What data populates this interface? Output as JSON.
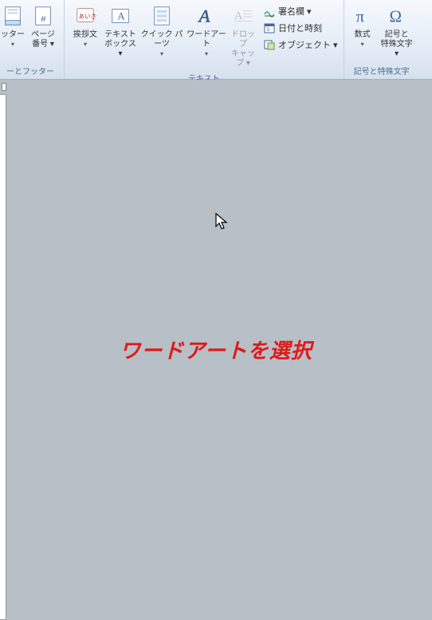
{
  "ribbon": {
    "groups": {
      "header_footer": {
        "label": "ーとフッター",
        "footer_btn": {
          "line1": "ッター",
          "line2": "▾"
        },
        "page_number_btn": {
          "line1": "ページ",
          "line2": "番号 ▾"
        }
      },
      "text": {
        "label": "テキスト",
        "greeting_btn": {
          "line1": "挨拶文",
          "line2": "▾"
        },
        "textbox_btn": {
          "line1": "テキスト",
          "line2": "ボックス ▾"
        },
        "quickparts_btn": {
          "line1": "クイック パーツ",
          "line2": "▾"
        },
        "wordart_btn": {
          "line1": "ワードアート",
          "line2": "▾"
        },
        "dropcap_btn": {
          "line1": "ドロップ",
          "line2": "キャップ ▾"
        },
        "signature": "署名欄 ▾",
        "datetime": "日付と時刻",
        "object": "オブジェクト ▾"
      },
      "symbols": {
        "label": "記号と特殊文字",
        "equation_btn": {
          "line1": "数式",
          "line2": "▾"
        },
        "symbol_btn": {
          "line1": "記号と",
          "line2": "特殊文字 ▾"
        }
      }
    }
  },
  "overlay": {
    "message": "ワードアートを選択"
  }
}
